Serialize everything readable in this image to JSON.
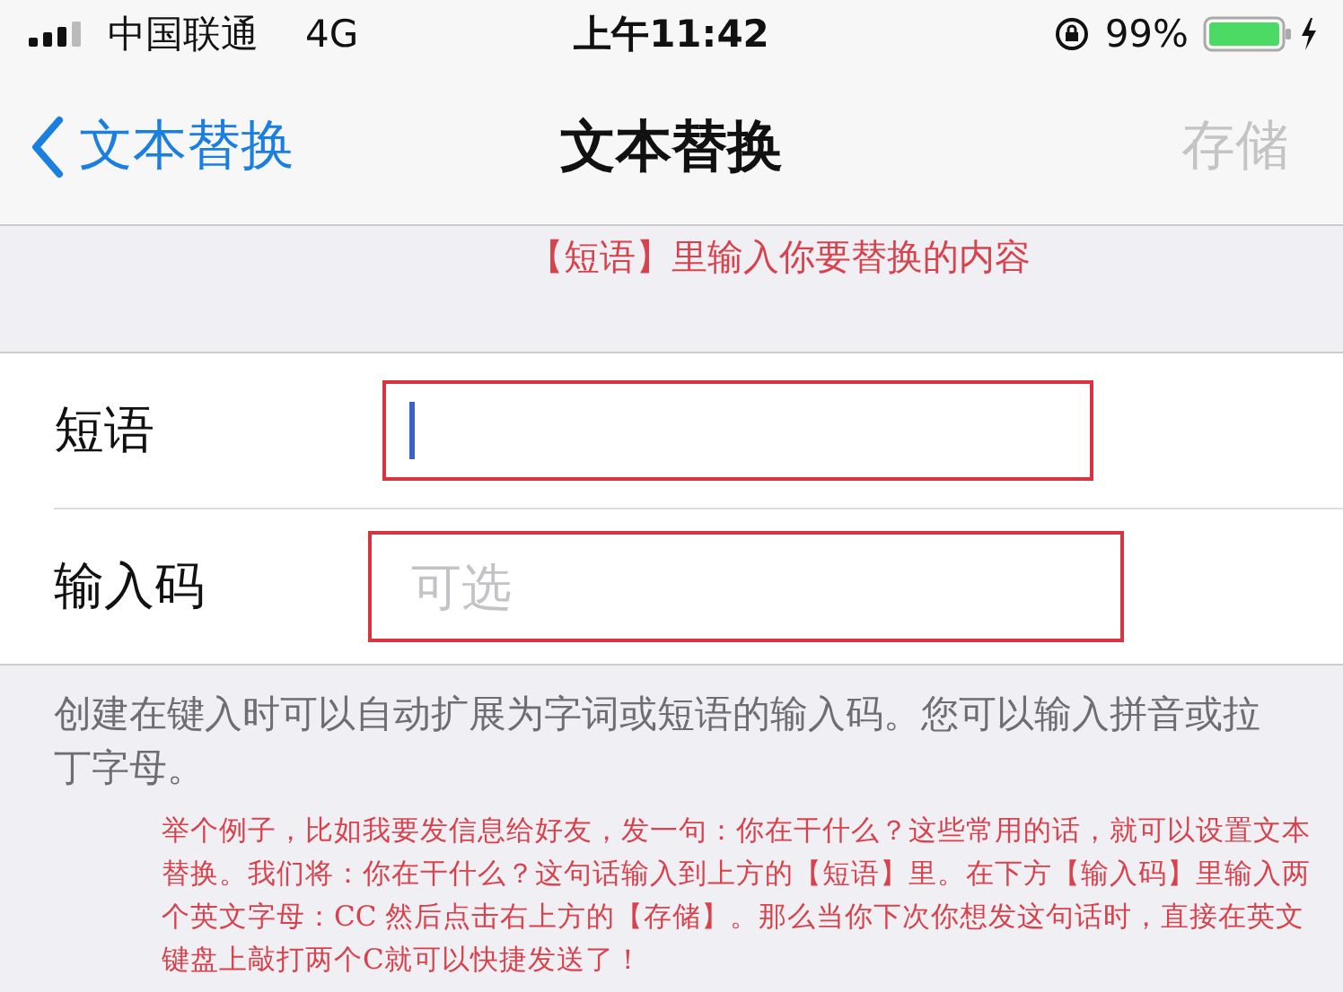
{
  "status_bar": {
    "carrier": "中国联通",
    "network": "4G",
    "time": "上午11:42",
    "battery": "99%"
  },
  "nav_bar": {
    "back": "文本替换",
    "title": "文本替换",
    "save": {
      "label": "存储",
      "disabled": true
    }
  },
  "annotation_top": "【短语】里输入你要替换的内容",
  "fields": [
    {
      "label": "短语",
      "focused": true
    },
    {
      "label": "输入码",
      "placeholder": "可选",
      "focused": false
    }
  ],
  "footer": "创建在键入时可以自动扩展为字词或短语的输入码。您可以输入拼音或拉丁字母。",
  "annotation_bottom": "举个例子，比如我要发信息给好友，发一句：你在干什么？这些常用的话，就可以设置文本替换。我们将：你在干什么？这句话输入到上方的【短语】里。在下方【输入码】里输入两个英文字母：CC 然后点击右上方的【存储】。那么当你下次你想发这句话时，直接在英文键盘上敲打两个C就可以快捷发送了！"
}
